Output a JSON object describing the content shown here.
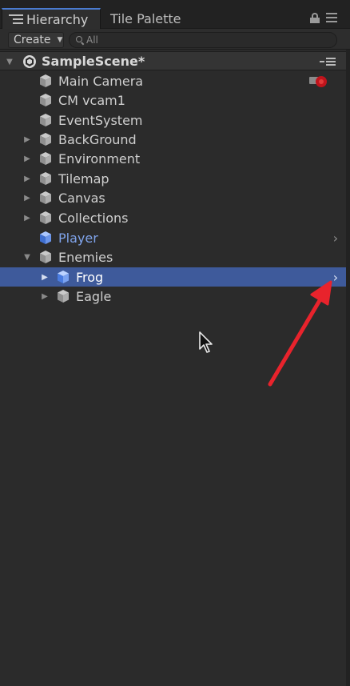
{
  "tabs": {
    "hierarchy": "Hierarchy",
    "tile_palette": "Tile Palette"
  },
  "toolbar": {
    "create_label": "Create",
    "search_placeholder": "All"
  },
  "scene": {
    "name": "SampleScene*"
  },
  "hierarchy": {
    "items": [
      {
        "label": "Main Camera",
        "depth": 1,
        "has_children": false,
        "prefab": false
      },
      {
        "label": "CM vcam1",
        "depth": 1,
        "has_children": false,
        "prefab": false
      },
      {
        "label": "EventSystem",
        "depth": 1,
        "has_children": false,
        "prefab": false
      },
      {
        "label": "BackGround",
        "depth": 1,
        "has_children": true,
        "expanded": false,
        "prefab": false
      },
      {
        "label": "Environment",
        "depth": 1,
        "has_children": true,
        "expanded": false,
        "prefab": false
      },
      {
        "label": "Tilemap",
        "depth": 1,
        "has_children": true,
        "expanded": false,
        "prefab": false
      },
      {
        "label": "Canvas",
        "depth": 1,
        "has_children": true,
        "expanded": false,
        "prefab": false
      },
      {
        "label": "Collections",
        "depth": 1,
        "has_children": true,
        "expanded": false,
        "prefab": false
      },
      {
        "label": "Player",
        "depth": 1,
        "has_children": false,
        "prefab": true
      },
      {
        "label": "Enemies",
        "depth": 1,
        "has_children": true,
        "expanded": true,
        "prefab": false
      },
      {
        "label": "Frog",
        "depth": 2,
        "has_children": true,
        "expanded": false,
        "prefab": true,
        "selected": true
      },
      {
        "label": "Eagle",
        "depth": 2,
        "has_children": true,
        "expanded": false,
        "prefab": false
      }
    ]
  },
  "colors": {
    "selection": "#3e5a9b",
    "prefab_text": "#7fa3ea",
    "annotation_arrow": "#e8232c"
  },
  "icons": {
    "tab": "hierarchy-list-icon",
    "lock": "lock-icon",
    "menu": "panel-menu-icon",
    "search": "search-icon",
    "scene": "unity-scene-icon",
    "gameobject": "cube-icon",
    "prefab": "blue-cube-icon",
    "chevron": "chevron-right-icon"
  }
}
